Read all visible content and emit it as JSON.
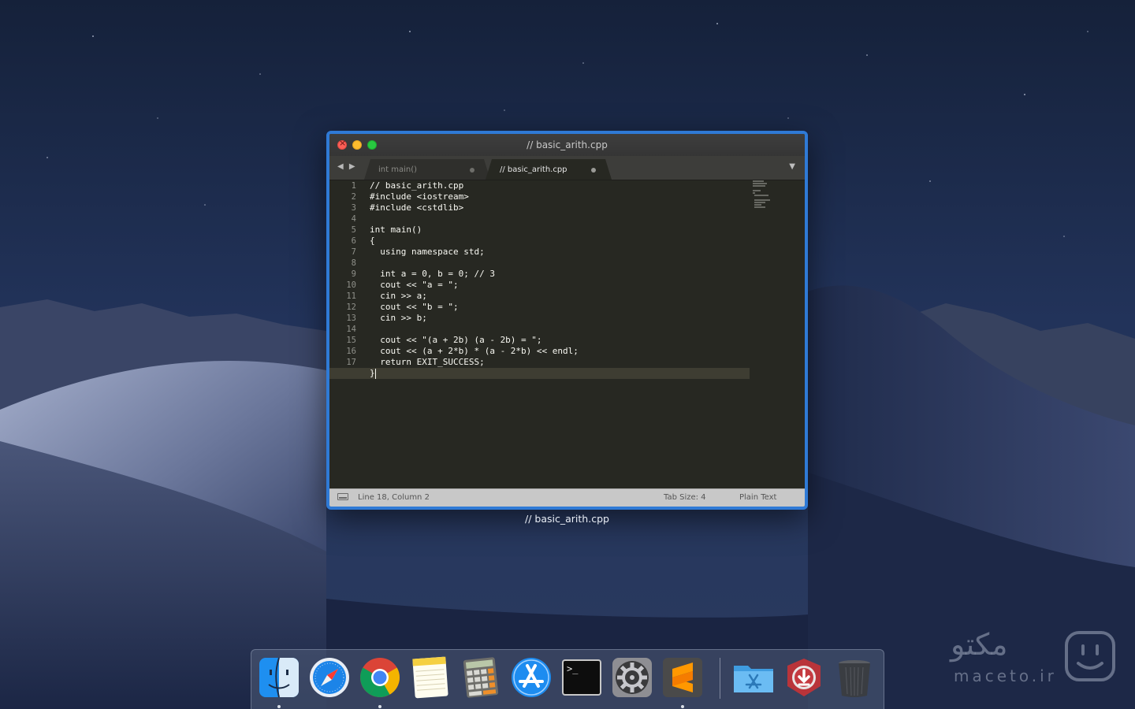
{
  "desktop": {
    "colors": {
      "sky_top": "#15213a",
      "sky_bottom": "#2a3a5e",
      "dune_light": "#8f9bb8"
    }
  },
  "window": {
    "title": "// basic_arith.cpp",
    "caption": "// basic_arith.cpp",
    "accent": "#2f7ad6",
    "nav_arrows": "◀ ▶",
    "tabs": [
      {
        "label": "int main()",
        "active": false
      },
      {
        "label": "// basic_arith.cpp",
        "active": true
      }
    ],
    "tab_dropdown": "▼",
    "editor": {
      "current_line": 18,
      "lines": [
        "// basic_arith.cpp",
        "#include <iostream>",
        "#include <cstdlib>",
        "",
        "int main()",
        "{",
        "  using namespace std;",
        "",
        "  int a = 0, b = 0; // 3",
        "  cout << \"a = \";",
        "  cin >> a;",
        "  cout << \"b = \";",
        "  cin >> b;",
        "",
        "  cout << \"(a + 2b) (a - 2b) = \";",
        "  cout << (a + 2*b) * (a - 2*b) << endl;",
        "  return EXIT_SUCCESS;",
        "}"
      ],
      "line_numbers": [
        "1",
        "2",
        "3",
        "4",
        "5",
        "6",
        "7",
        "8",
        "9",
        "10",
        "11",
        "12",
        "13",
        "14",
        "15",
        "16",
        "17",
        "18"
      ]
    },
    "status": {
      "position": "Line 18, Column 2",
      "tab_size": "Tab Size: 4",
      "syntax": "Plain Text"
    }
  },
  "dock": {
    "items": [
      {
        "name": "finder",
        "running": true
      },
      {
        "name": "safari",
        "running": false
      },
      {
        "name": "chrome",
        "running": true
      },
      {
        "name": "notes",
        "running": false
      },
      {
        "name": "calculator",
        "running": false
      },
      {
        "name": "app-store",
        "running": false
      },
      {
        "name": "terminal",
        "running": false
      },
      {
        "name": "system-preferences",
        "running": false
      },
      {
        "name": "sublime-text",
        "running": true
      },
      {
        "name": "applications-folder",
        "running": false
      },
      {
        "name": "downloader",
        "running": false
      },
      {
        "name": "trash",
        "running": false
      }
    ],
    "terminal_prompt": ">_"
  },
  "watermark": {
    "persian": "مکتو",
    "latin": "maceto.ir"
  }
}
